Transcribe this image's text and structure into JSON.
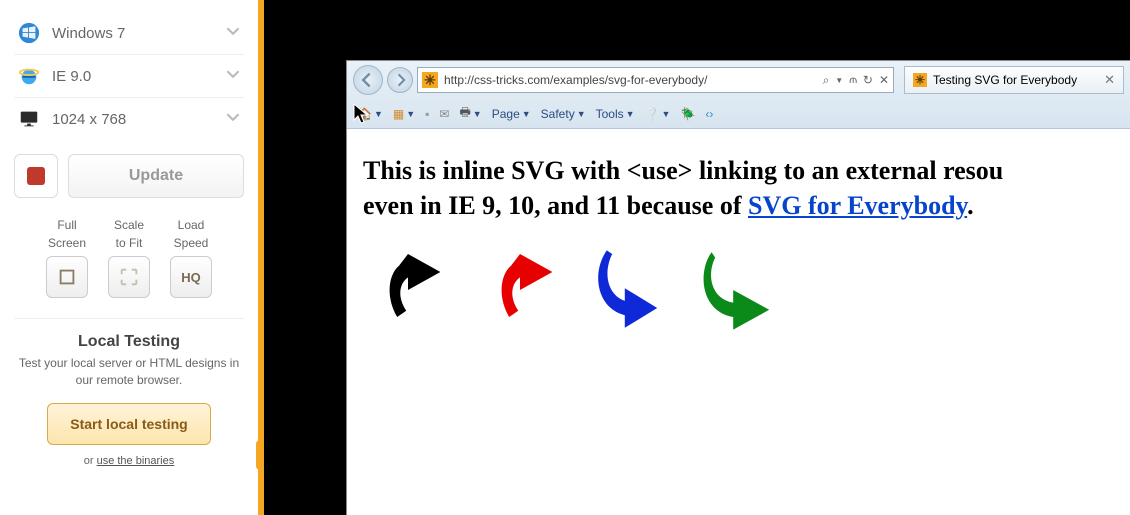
{
  "sidebar": {
    "os_label": "Windows 7",
    "browser_label": "IE 9.0",
    "resolution_label": "1024 x 768",
    "update_button": "Update",
    "tools": {
      "full_screen": {
        "line1": "Full",
        "line2": "Screen"
      },
      "scale_to_fit": {
        "line1": "Scale",
        "line2": "to Fit"
      },
      "load_speed": {
        "line1": "Load",
        "line2": "Speed",
        "badge": "HQ"
      }
    },
    "local": {
      "title": "Local Testing",
      "desc": "Test your local server or HTML designs in our remote browser.",
      "button": "Start local testing",
      "or_text": "or ",
      "binaries_link": "use the binaries"
    }
  },
  "ie": {
    "url": "http://css-tricks.com/examples/svg-for-everybody/",
    "search_tools": "⌕ ▾",
    "tab_title": "Testing SVG for Everybody",
    "menus": {
      "page": "Page",
      "safety": "Safety",
      "tools": "Tools"
    },
    "page": {
      "line1_a": "This is inline SVG with <use> linking to an external resou",
      "line2_a": "even in IE 9, 10, and 11 because of ",
      "link_text": "SVG for Everybody",
      "period": "."
    }
  }
}
